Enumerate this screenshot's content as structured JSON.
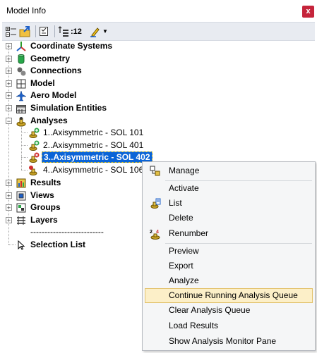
{
  "window": {
    "title": "Model Info",
    "close_label": "x"
  },
  "toolbar": {
    "count_label": ":12"
  },
  "tree": {
    "nodes": [
      {
        "label": "Coordinate Systems",
        "icon": "axes-icon"
      },
      {
        "label": "Geometry",
        "icon": "cylinder-icon"
      },
      {
        "label": "Connections",
        "icon": "connection-icon"
      },
      {
        "label": "Model",
        "icon": "grid-icon"
      },
      {
        "label": "Aero Model",
        "icon": "aircraft-icon"
      },
      {
        "label": "Simulation Entities",
        "icon": "calendar-icon"
      },
      {
        "label": "Analyses",
        "icon": "analysis-icon"
      },
      {
        "label": "Results",
        "icon": "results-icon"
      },
      {
        "label": "Views",
        "icon": "views-icon"
      },
      {
        "label": "Groups",
        "icon": "groups-icon"
      },
      {
        "label": "Layers",
        "icon": "layers-icon"
      }
    ],
    "analyses": [
      {
        "label": "1..Axisymmetric - SOL 101"
      },
      {
        "label": "2..Axisymmetric - SOL 401"
      },
      {
        "label": "3..Axisymmetric - SOL 402"
      },
      {
        "label": "4..Axisymmetric - SOL 106"
      }
    ],
    "separator_text": "--------------------------",
    "selection_list": "Selection List"
  },
  "context_menu": {
    "items": [
      {
        "label": "Manage"
      },
      {
        "label": "Activate"
      },
      {
        "label": "List"
      },
      {
        "label": "Delete"
      },
      {
        "label": "Renumber"
      },
      {
        "label": "Preview"
      },
      {
        "label": "Export"
      },
      {
        "label": "Analyze"
      },
      {
        "label": "Continue Running Analysis Queue"
      },
      {
        "label": "Clear Analysis Queue"
      },
      {
        "label": "Load Results"
      },
      {
        "label": "Show Analysis Monitor Pane"
      }
    ]
  }
}
